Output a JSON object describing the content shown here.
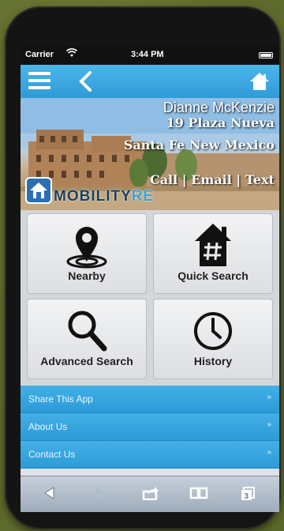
{
  "status_bar": {
    "carrier": "Carrier",
    "time": "3:44 PM"
  },
  "nav": {
    "menu_icon": "menu-icon",
    "back_icon": "chevron-left-icon",
    "home_icon": "home-icon"
  },
  "hero": {
    "agent_name": "Dianne McKenzie",
    "address_line1": "19 Plaza Nueva",
    "address_line2": "Santa Fe New Mexico",
    "contact": [
      "Call",
      "Email",
      "Text"
    ],
    "separator": " | ",
    "logo_text_main": "MOBILITY",
    "logo_text_accent": "RE"
  },
  "tiles": [
    {
      "label": "Nearby",
      "icon": "location-pin-icon"
    },
    {
      "label": "Quick Search",
      "icon": "house-hash-icon"
    },
    {
      "label": "Advanced Search",
      "icon": "magnifier-icon"
    },
    {
      "label": "History",
      "icon": "clock-icon"
    }
  ],
  "list": [
    {
      "label": "Share This App"
    },
    {
      "label": "About Us"
    },
    {
      "label": "Contact Us"
    }
  ],
  "list_arrow": "»",
  "toolbar": {
    "icons": [
      "back-arrow-icon",
      "forward-arrow-icon",
      "share-icon",
      "bookmarks-icon",
      "tabs-icon"
    ],
    "tabs_count": "3"
  },
  "colors": {
    "accent": "#2f9bd6",
    "background": "#5f6b2c"
  }
}
